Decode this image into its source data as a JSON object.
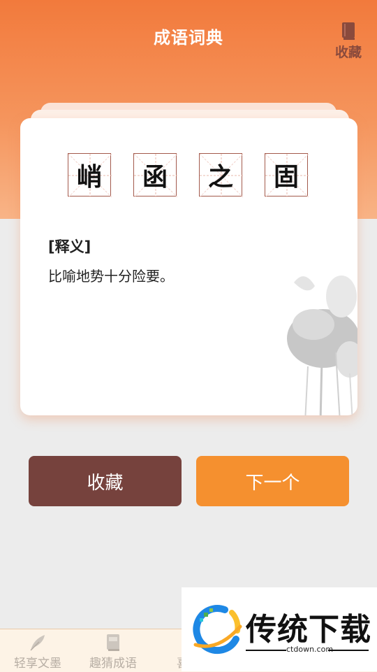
{
  "header": {
    "title": "成语词典",
    "favorites_label": "收藏"
  },
  "idiom": {
    "characters": [
      "峭",
      "函",
      "之",
      "固"
    ],
    "meaning_label": "[释义]",
    "meaning": "比喻地势十分险要。"
  },
  "actions": {
    "favorite_label": "收藏",
    "next_label": "下一个"
  },
  "tabbar": {
    "items": [
      {
        "label": "轻享文墨",
        "icon": "feather-icon"
      },
      {
        "label": "趣猜成语",
        "icon": "book-icon"
      },
      {
        "label": "喜读",
        "icon": "tab-icon"
      }
    ]
  },
  "watermark": {
    "brand": "传统下载",
    "url": "ctdown.com"
  },
  "colors": {
    "header_top": "#f27a3c",
    "favorite_button": "#76423d",
    "next_button": "#f5902f",
    "grid_border": "#a35a4c"
  }
}
